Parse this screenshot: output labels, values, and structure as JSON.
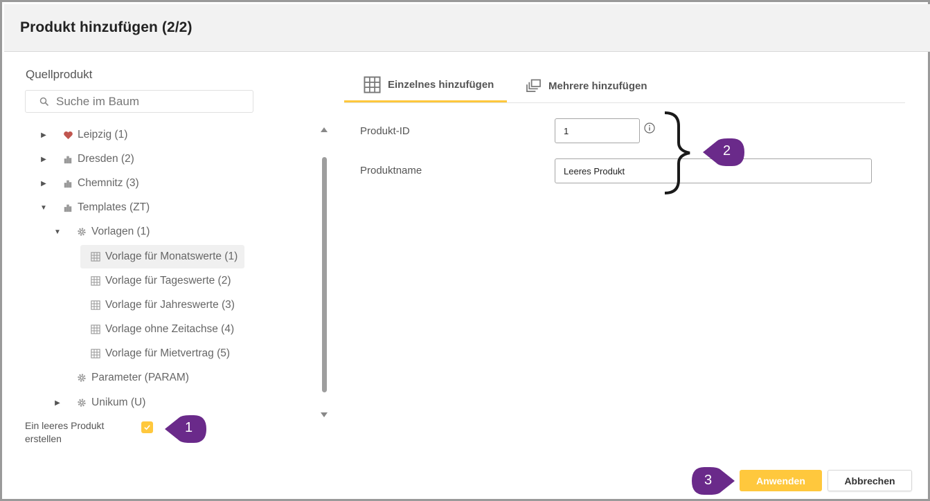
{
  "dialog": {
    "title": "Produkt hinzufügen (2/2)"
  },
  "left": {
    "section_label": "Quellprodukt",
    "search": {
      "placeholder": "Suche im Baum",
      "value": ""
    },
    "tree": [
      {
        "label": "Leipzig (1)",
        "icon": "heart-icon",
        "expander": "collapsed"
      },
      {
        "label": "Dresden (2)",
        "icon": "building-icon",
        "expander": "collapsed"
      },
      {
        "label": "Chemnitz (3)",
        "icon": "building-icon",
        "expander": "collapsed"
      },
      {
        "label": "Templates (ZT)",
        "icon": "building-icon",
        "expander": "expanded"
      },
      {
        "label": "Vorlagen (1)",
        "icon": "gear-icon",
        "expander": "expanded"
      },
      {
        "label": "Vorlage für Monatswerte (1)",
        "icon": "grid-icon",
        "selected": true
      },
      {
        "label": "Vorlage für Tageswerte (2)",
        "icon": "grid-icon"
      },
      {
        "label": "Vorlage für Jahreswerte (3)",
        "icon": "grid-icon"
      },
      {
        "label": "Vorlage ohne Zeitachse (4)",
        "icon": "grid-icon"
      },
      {
        "label": "Vorlage für Mietvertrag (5)",
        "icon": "grid-icon"
      },
      {
        "label": "Parameter (PARAM)",
        "icon": "gear-icon"
      },
      {
        "label": "Unikum (U)",
        "icon": "gear-icon",
        "expander": "collapsed"
      }
    ],
    "empty_product": {
      "label": "Ein leeres Produkt erstellen",
      "checked": true
    }
  },
  "tabs": [
    {
      "label": "Einzelnes hinzufügen",
      "icon": "grid-icon",
      "active": true
    },
    {
      "label": "Mehrere hinzufügen",
      "icon": "stack-icon",
      "active": false
    }
  ],
  "form": {
    "product_id": {
      "label": "Produkt-ID",
      "value": "1"
    },
    "product_name": {
      "label": "Produktname",
      "value": "Leeres Produkt"
    }
  },
  "callouts": {
    "one": "1",
    "two": "2",
    "three": "3"
  },
  "buttons": {
    "apply": "Anwenden",
    "cancel": "Abbrechen"
  },
  "colors": {
    "accent": "#ffc83d",
    "callout": "#6a2a8a",
    "heart": "#c0564f"
  }
}
